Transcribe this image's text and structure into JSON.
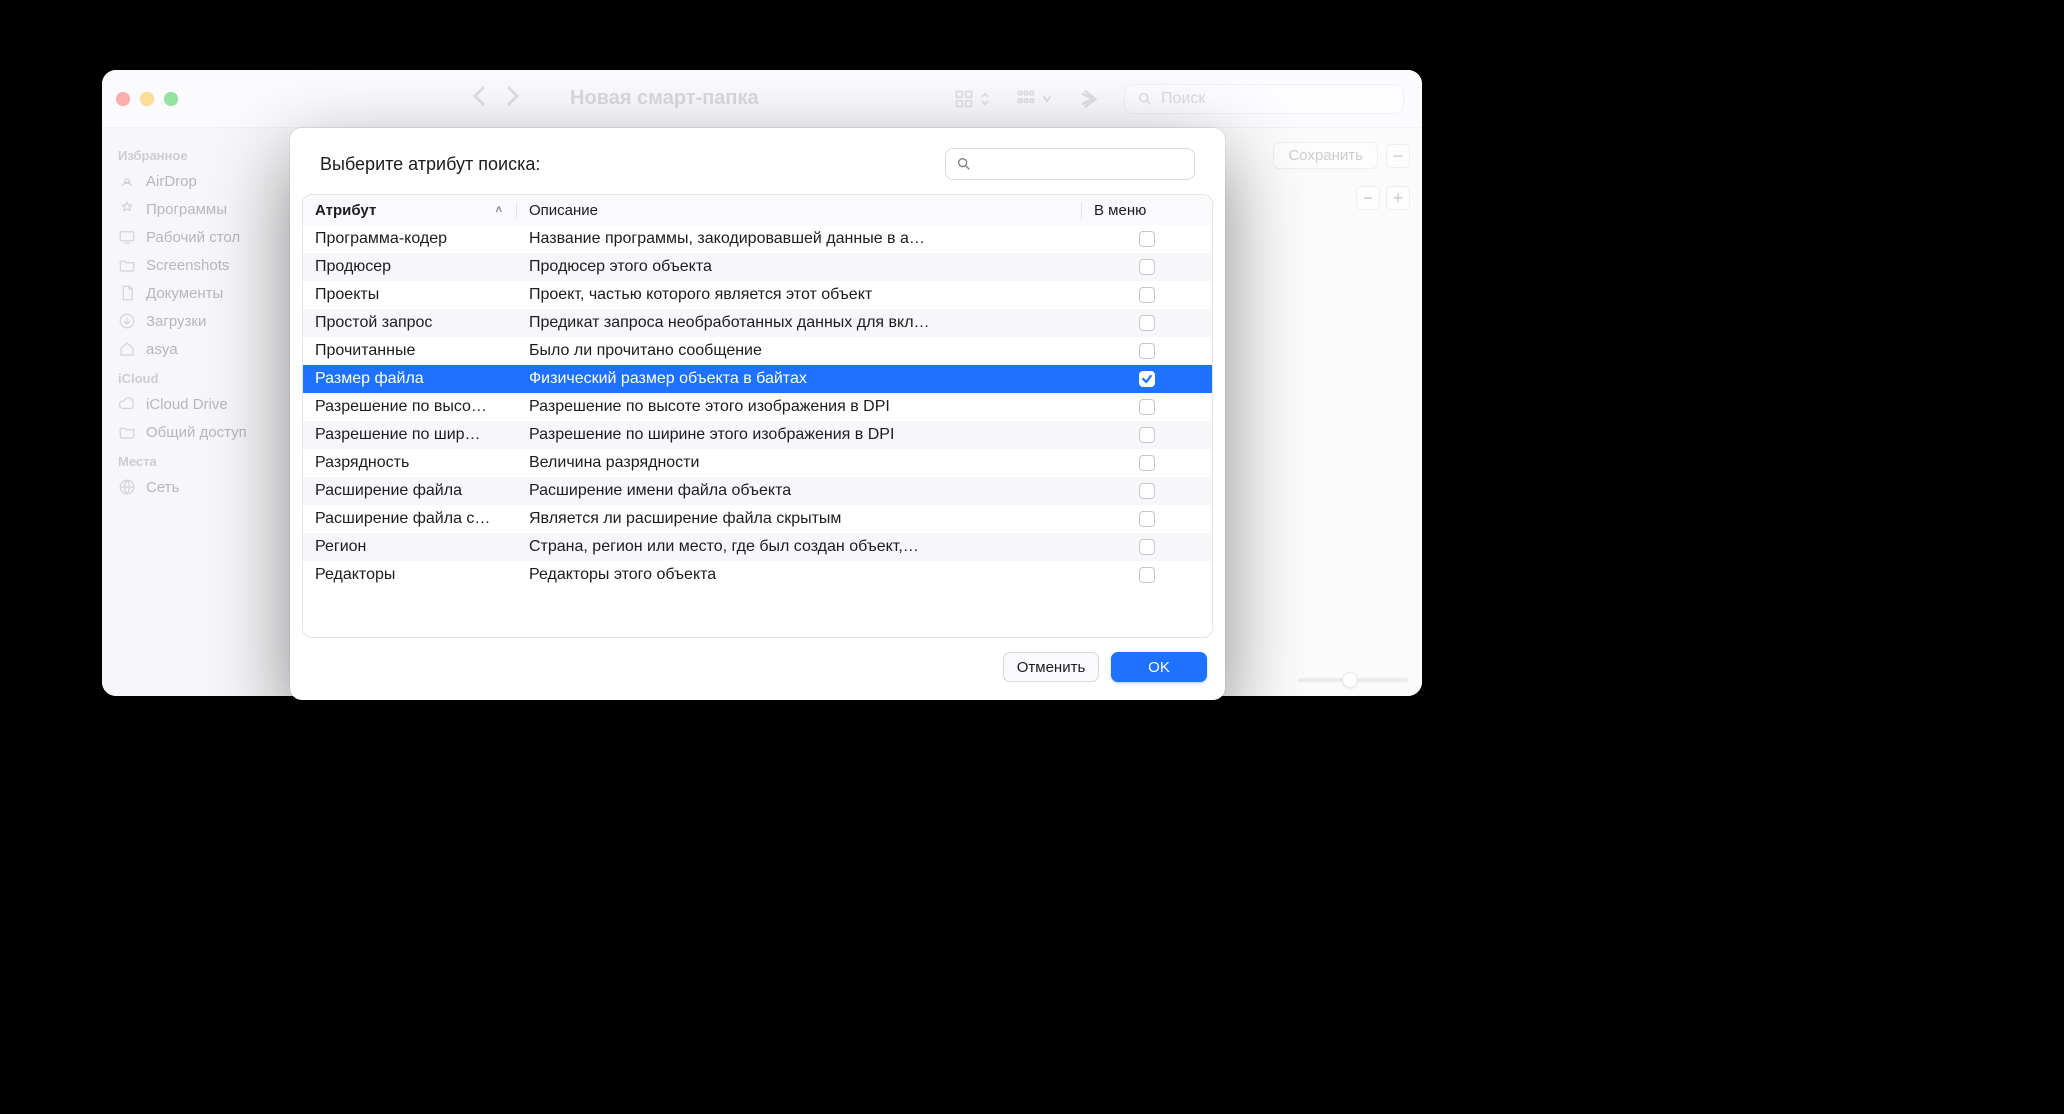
{
  "finder": {
    "title": "Новая смарт-папка",
    "search_placeholder": "Поиск",
    "save_label": "Сохранить",
    "minus_label": "−",
    "plus_label": "+"
  },
  "sidebar": {
    "sections": [
      {
        "title": "Избранное",
        "items": [
          {
            "icon": "airdrop",
            "label": "AirDrop"
          },
          {
            "icon": "apps",
            "label": "Программы"
          },
          {
            "icon": "desktop",
            "label": "Рабочий стол"
          },
          {
            "icon": "folder",
            "label": "Screenshots"
          },
          {
            "icon": "doc",
            "label": "Документы"
          },
          {
            "icon": "download",
            "label": "Загрузки"
          },
          {
            "icon": "home",
            "label": "asya"
          }
        ]
      },
      {
        "title": "iCloud",
        "items": [
          {
            "icon": "cloud",
            "label": "iCloud Drive"
          },
          {
            "icon": "shared",
            "label": "Общий доступ"
          }
        ]
      },
      {
        "title": "Места",
        "items": [
          {
            "icon": "network",
            "label": "Сеть"
          }
        ]
      }
    ]
  },
  "sheet": {
    "title": "Выберите атрибут поиска:",
    "columns": {
      "attr": "Атрибут",
      "desc": "Описание",
      "menu": "В меню"
    },
    "cancel_label": "Отменить",
    "ok_label": "OK",
    "rows": [
      {
        "attr": "Программа-кодер",
        "desc": "Название программы, закодировавшей данные в а…",
        "checked": false,
        "selected": false
      },
      {
        "attr": "Продюсер",
        "desc": "Продюсер этого объекта",
        "checked": false,
        "selected": false
      },
      {
        "attr": "Проекты",
        "desc": "Проект, частью которого является этот объект",
        "checked": false,
        "selected": false
      },
      {
        "attr": "Простой запрос",
        "desc": "Предикат запроса необработанных данных для вкл…",
        "checked": false,
        "selected": false
      },
      {
        "attr": "Прочитанные",
        "desc": "Было ли прочитано сообщение",
        "checked": false,
        "selected": false
      },
      {
        "attr": "Размер файла",
        "desc": "Физический размер объекта в байтах",
        "checked": true,
        "selected": true
      },
      {
        "attr": "Разрешение по высо…",
        "desc": "Разрешение по высоте этого изображения в DPI",
        "checked": false,
        "selected": false
      },
      {
        "attr": "Разрешение по шир…",
        "desc": "Разрешение по ширине этого изображения в DPI",
        "checked": false,
        "selected": false
      },
      {
        "attr": "Разрядность",
        "desc": "Величина разрядности",
        "checked": false,
        "selected": false
      },
      {
        "attr": "Расширение файла",
        "desc": "Расширение имени файла объекта",
        "checked": false,
        "selected": false
      },
      {
        "attr": "Расширение файла с…",
        "desc": "Является ли расширение файла скрытым",
        "checked": false,
        "selected": false
      },
      {
        "attr": "Регион",
        "desc": "Страна, регион или место, где был создан объект,…",
        "checked": false,
        "selected": false
      },
      {
        "attr": "Редакторы",
        "desc": "Редакторы этого объекта",
        "checked": false,
        "selected": false
      }
    ]
  }
}
